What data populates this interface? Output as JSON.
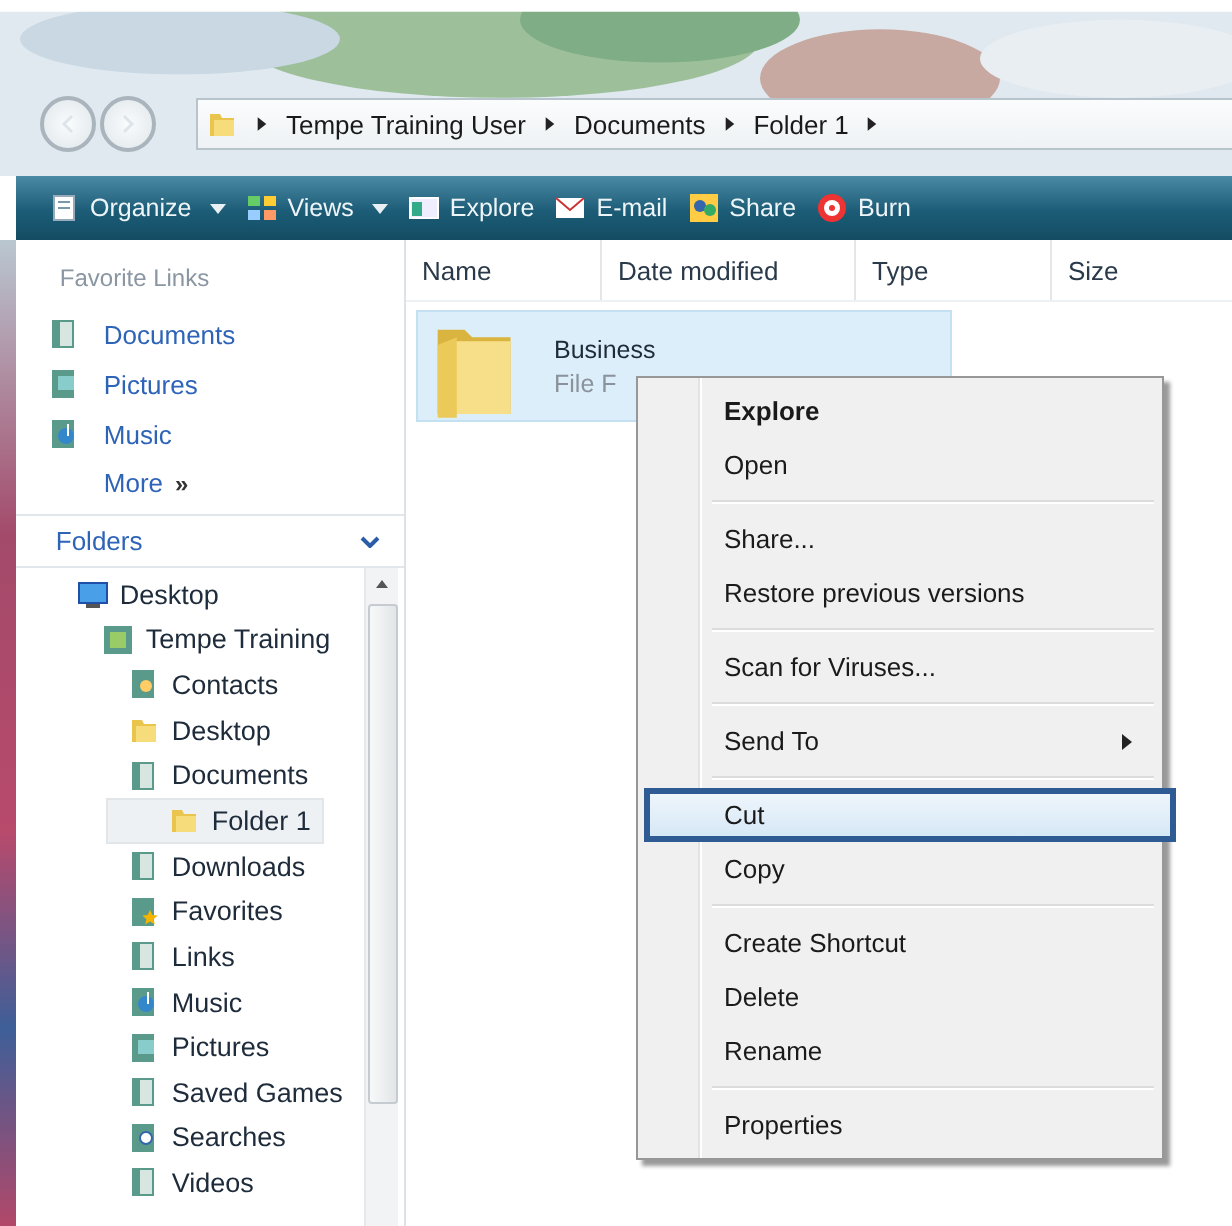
{
  "address_bar": {
    "crumbs": [
      "Tempe Training User",
      "Documents",
      "Folder 1"
    ]
  },
  "toolbar": [
    {
      "label": "Organize",
      "kind": "organize",
      "dropdown": true
    },
    {
      "label": "Views",
      "kind": "views",
      "dropdown": true
    },
    {
      "label": "Explore",
      "kind": "explore",
      "dropdown": false
    },
    {
      "label": "E-mail",
      "kind": "email",
      "dropdown": false
    },
    {
      "label": "Share",
      "kind": "share",
      "dropdown": false
    },
    {
      "label": "Burn",
      "kind": "burn",
      "dropdown": false
    }
  ],
  "favorite_links": {
    "title": "Favorite Links",
    "items": [
      {
        "label": "Documents",
        "kind": "documents"
      },
      {
        "label": "Pictures",
        "kind": "pictures"
      },
      {
        "label": "Music",
        "kind": "music"
      }
    ],
    "more": "More",
    "more_mark": "»"
  },
  "folders": {
    "title": "Folders",
    "expanded": true,
    "tree": [
      {
        "label": "Desktop",
        "kind": "desktop",
        "selected": false,
        "children": [
          {
            "label": "Tempe Training",
            "kind": "user",
            "selected": false,
            "children": [
              {
                "label": "Contacts",
                "kind": "contacts",
                "selected": false
              },
              {
                "label": "Desktop",
                "kind": "folder",
                "selected": false
              },
              {
                "label": "Documents",
                "kind": "documents",
                "selected": false,
                "children": [
                  {
                    "label": "Folder 1",
                    "kind": "folder",
                    "selected": true
                  }
                ]
              },
              {
                "label": "Downloads",
                "kind": "documents",
                "selected": false
              },
              {
                "label": "Favorites",
                "kind": "favorites",
                "selected": false
              },
              {
                "label": "Links",
                "kind": "documents",
                "selected": false
              },
              {
                "label": "Music",
                "kind": "music",
                "selected": false
              },
              {
                "label": "Pictures",
                "kind": "pictures",
                "selected": false
              },
              {
                "label": "Saved Games",
                "kind": "documents",
                "selected": false
              },
              {
                "label": "Searches",
                "kind": "searches",
                "selected": false
              },
              {
                "label": "Videos",
                "kind": "documents",
                "selected": false
              }
            ]
          }
        ]
      }
    ]
  },
  "columns": [
    "Name",
    "Date modified",
    "Type",
    "Size"
  ],
  "files": [
    {
      "name": "Business",
      "type": "File F",
      "selected": true
    }
  ],
  "context_menu": [
    {
      "kind": "item",
      "label": "Explore",
      "default": true,
      "selected": false
    },
    {
      "kind": "item",
      "label": "Open",
      "default": false,
      "selected": false
    },
    {
      "kind": "separator"
    },
    {
      "kind": "item",
      "label": "Share...",
      "default": false,
      "selected": false
    },
    {
      "kind": "item",
      "label": "Restore previous versions",
      "default": false,
      "selected": false
    },
    {
      "kind": "separator"
    },
    {
      "kind": "item",
      "label": "Scan for Viruses...",
      "default": false,
      "selected": false
    },
    {
      "kind": "separator"
    },
    {
      "kind": "submenu",
      "label": "Send To",
      "default": false,
      "selected": false
    },
    {
      "kind": "separator"
    },
    {
      "kind": "item",
      "label": "Cut",
      "default": false,
      "selected": true
    },
    {
      "kind": "item",
      "label": "Copy",
      "default": false,
      "selected": false
    },
    {
      "kind": "separator"
    },
    {
      "kind": "item",
      "label": "Create Shortcut",
      "default": false,
      "selected": false
    },
    {
      "kind": "item",
      "label": "Delete",
      "default": false,
      "selected": false
    },
    {
      "kind": "item",
      "label": "Rename",
      "default": false,
      "selected": false
    },
    {
      "kind": "separator"
    },
    {
      "kind": "item",
      "label": "Properties",
      "default": false,
      "selected": false
    }
  ]
}
